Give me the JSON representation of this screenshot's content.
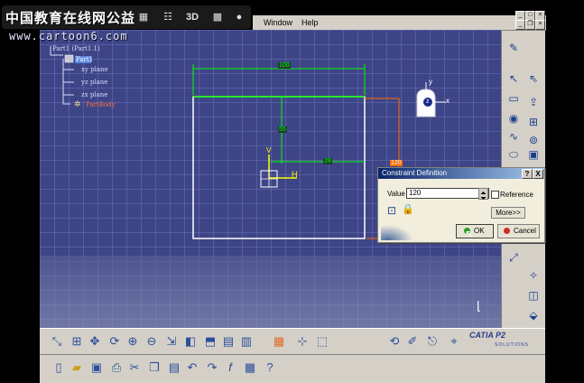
{
  "overlay": {
    "site_logo": "中国教育在线网公益",
    "site_url": "www.cartoon6.com",
    "mode_3d": "3D"
  },
  "menubar": {
    "items": [
      "Window",
      "Help"
    ]
  },
  "spec_tree": {
    "root": "Part1 (Part1.1)",
    "part_node": "Part1",
    "planes": [
      "xy plane",
      "yz plane",
      "zx plane"
    ],
    "active_item": "PartBody"
  },
  "sketch": {
    "dimensions": {
      "width": "100",
      "vertical": "55",
      "offset": "28",
      "right": "120"
    },
    "axis_labels": {
      "h": "H",
      "v": "V",
      "compass_x": "x",
      "compass_y": "y",
      "compass_z": "z"
    }
  },
  "dialog": {
    "title": "Constraint Definition",
    "help_btn": "?",
    "close_btn": "X",
    "value_label": "Value",
    "value": "120",
    "reference_label": "Reference",
    "more_btn": "More>>",
    "ok_btn": "OK",
    "cancel_btn": "Cancel"
  },
  "branding": {
    "catia": "CATIA P2",
    "solutions": "SOLUTIONS"
  },
  "icons": {
    "bottom_row1": [
      "fit-all",
      "pan",
      "rotate",
      "zoom-in",
      "zoom-out",
      "normal-view",
      "view-mode",
      "render",
      "hide-show",
      "swap",
      "grid",
      "snap",
      "construction",
      "update",
      "sketch",
      "exit-sketch",
      "compass"
    ],
    "bottom_row2": [
      "new",
      "open",
      "save",
      "print",
      "cut",
      "copy",
      "paste",
      "undo",
      "redo",
      "formula",
      "table",
      "whats-this"
    ]
  },
  "colors": {
    "viewport_bg": "#3e4586",
    "sketch_white": "#ffffff",
    "dimension_green": "#00ff00",
    "dimension_orange": "#ff6a00",
    "titlebar": "#0a246a"
  }
}
